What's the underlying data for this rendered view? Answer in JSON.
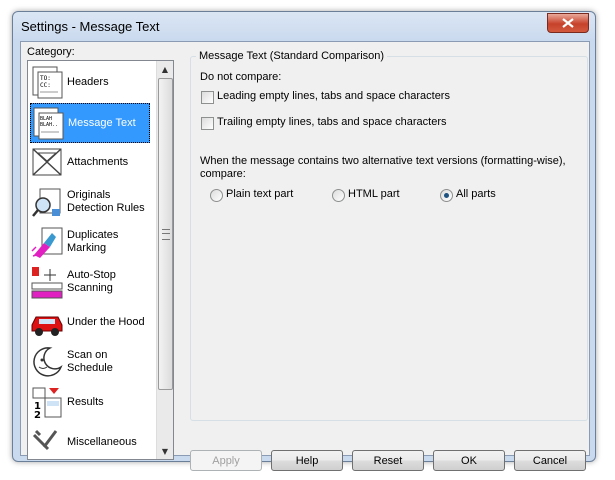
{
  "window": {
    "title": "Settings - Message Text"
  },
  "sidebar": {
    "category_label": "Category:",
    "items": [
      {
        "label": "Headers",
        "icon": "headers-icon"
      },
      {
        "label": "Message Text",
        "icon": "message-text-icon",
        "selected": true
      },
      {
        "label": "Attachments",
        "icon": "attachments-icon"
      },
      {
        "label": "Originals\nDetection Rules",
        "icon": "originals-detection-icon"
      },
      {
        "label": "Duplicates\nMarking",
        "icon": "duplicates-marking-icon"
      },
      {
        "label": "Auto-Stop\nScanning",
        "icon": "auto-stop-icon"
      },
      {
        "label": "Under the Hood",
        "icon": "car-icon"
      },
      {
        "label": "Scan on Schedule",
        "icon": "moon-clock-icon"
      },
      {
        "label": "Results",
        "icon": "results-icon"
      },
      {
        "label": "Miscellaneous",
        "icon": "tools-icon"
      }
    ]
  },
  "panel": {
    "group_title": "Message Text (Standard Comparison)",
    "do_not_compare_label": "Do not compare:",
    "leading_label": "Leading empty lines, tabs and space characters",
    "trailing_label": "Trailing empty lines, tabs and space characters",
    "leading_checked": false,
    "trailing_checked": false,
    "alt_versions_label": "When the message contains two alternative text versions (formatting-wise),\ncompare:",
    "radio_options": [
      "Plain text part",
      "HTML part",
      "All parts"
    ],
    "selected_radio": "All parts"
  },
  "buttons": {
    "apply": "Apply",
    "help": "Help",
    "reset": "Reset",
    "ok": "OK",
    "cancel": "Cancel"
  },
  "colors": {
    "selection": "#3399ff",
    "window_frame": "#c9d9ee",
    "close_button": "#c7412a"
  }
}
